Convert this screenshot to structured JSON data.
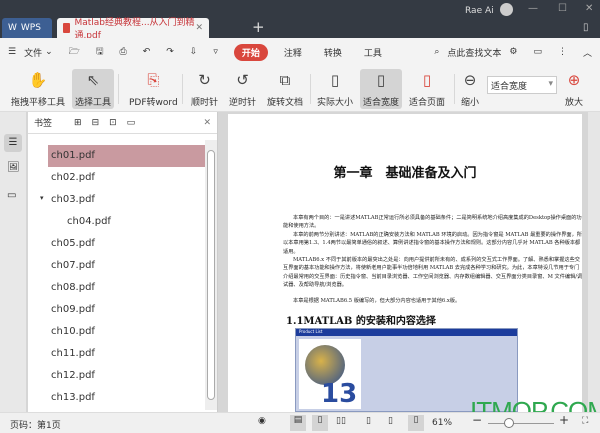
{
  "titlebar": {
    "user": "Rae Ai",
    "minimize": "—",
    "maximize": "☐",
    "close": "✕"
  },
  "tabs": [
    {
      "label": "WPS"
    },
    {
      "label": "Matlab经典教程...从入门到精通.pdf"
    }
  ],
  "menubar": {
    "file": "文件",
    "items": [
      "开始",
      "注释",
      "转换",
      "工具"
    ],
    "search": "点此查找文本"
  },
  "ribbon": [
    "拖拽平移工具",
    "选择工具",
    "PDF转word",
    "顺时针",
    "逆时针",
    "旋转文档",
    "实际大小",
    "适合宽度",
    "适合页面",
    "缩小",
    "放大"
  ],
  "zoom_select": "适合宽度",
  "bookmarks": {
    "title": "书签",
    "items": [
      "ch01.pdf",
      "ch02.pdf",
      "ch03.pdf",
      "ch04.pdf",
      "ch05.pdf",
      "ch07.pdf",
      "ch08.pdf",
      "ch09.pdf",
      "ch10.pdf",
      "ch11.pdf",
      "ch12.pdf",
      "ch13.pdf"
    ]
  },
  "page": {
    "chapter_title": "第一章　基础准备及入门",
    "paragraphs": [
      "本章有两个目的：一是讲述MATLAB正常运行所必须具备的基础条件；二是简明系统地介绍高度集成的Desktop操作桌面的功能和使用方法。",
      "本章的前两节分别讲述：MATLAB的正确安装方法和 MATLAB 环境的启动。因为指令窗是 MATLAB 最重要的操作界面，所以本章用第1.3、1.4两节以最简单通俗的叙述、算例讲述指令窗的基本操作方法和规则。这部分内容几乎对 MATLAB 各种版本都适用。",
      "MATLAB6.x 不同于其前版本的最突出之处是：向用户提供前所未有的、成系列的交互式工作界面。了解、熟悉和掌握这些交互界面的基本功能和操作方法，将使新老用户能事半功倍地利用 MATLAB 去完成各种学习和研究。为此，本章特设几节用于专门介绍最常用的交互界面：历史指令窗、当前目录浏览器、工作空间浏览器、内存数组编辑器、交互界面分类目录窗、M 文件编辑/调试器、及帮助导航/浏览器。",
      "本章是根据 MATLAB6.5 版编写的，但大部分内容也适用于其他6.x版。"
    ],
    "section": "1.1MATLAB 的安装和内容选择",
    "figure_text": "Product List"
  },
  "status": {
    "page": "页码：第1页",
    "zoom": "61%"
  },
  "watermark": "ITMOP.COM"
}
